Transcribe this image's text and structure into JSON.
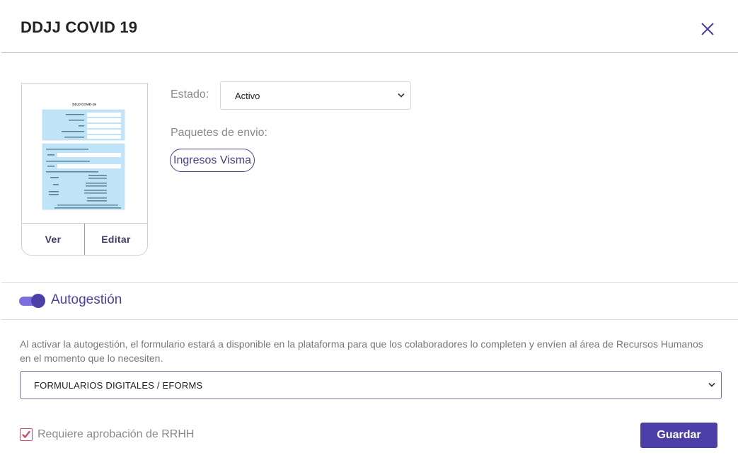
{
  "modal": {
    "title": "DDJJ COVID 19",
    "close_icon": "close-icon"
  },
  "form_preview": {
    "doc_title": "DDJJ COVID-19",
    "view_label": "Ver",
    "edit_label": "Editar"
  },
  "estado": {
    "label": "Estado:",
    "value": "Activo"
  },
  "paquetes": {
    "label": "Paquetes de envio:",
    "items": [
      "Ingresos Visma"
    ]
  },
  "autogestion": {
    "title": "Autogestión",
    "enabled": true,
    "description": "Al activar la autogestión, el formulario estará a disponible en la plataforma para que los colaboradores lo completen y envíen al área de Recursos Humanos en el momento que lo necesiten.",
    "category_value": "FORMULARIOS DIGITALES / EFORMS"
  },
  "approval": {
    "label": "Requiere aprobación de RRHH",
    "checked": true
  },
  "save_label": "Guardar",
  "colors": {
    "accent": "#4c3fa8",
    "toggle_track": "#7b6fe0",
    "check": "#d04a73"
  }
}
